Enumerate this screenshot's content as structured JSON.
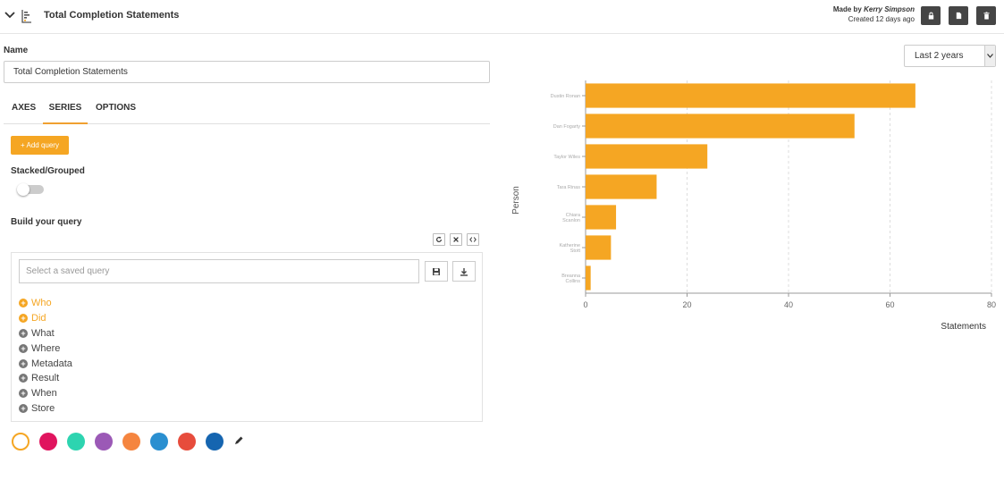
{
  "header": {
    "title": "Total Completion Statements",
    "made_by_prefix": "Made by",
    "author": "Kerry Simpson",
    "created": "Created 12 days ago",
    "buttons": [
      "lock-icon",
      "copy-icon",
      "trash-icon"
    ]
  },
  "name_field": {
    "label": "Name",
    "value": "Total Completion Statements"
  },
  "tabs": [
    {
      "label": "AXES",
      "active": false
    },
    {
      "label": "SERIES",
      "active": true
    },
    {
      "label": "OPTIONS",
      "active": false
    }
  ],
  "add_query_label": "+ Add query",
  "stacked_label": "Stacked/Grouped",
  "build_label": "Build your query",
  "saved_query_placeholder": "Select a saved query",
  "query_items": [
    {
      "label": "Who",
      "state": "active"
    },
    {
      "label": "Did",
      "state": "active"
    },
    {
      "label": "What",
      "state": "inactive"
    },
    {
      "label": "Where",
      "state": "inactive"
    },
    {
      "label": "Metadata",
      "state": "inactive"
    },
    {
      "label": "Result",
      "state": "inactive"
    },
    {
      "label": "When",
      "state": "inactive"
    },
    {
      "label": "Store",
      "state": "inactive"
    }
  ],
  "swatches": [
    "#ffffff",
    "#e0145e",
    "#2dd4b0",
    "#9b59b6",
    "#f5853f",
    "#2a8fd0",
    "#e74c3c",
    "#1565b0"
  ],
  "accent_color": "#f5a623",
  "time_range": {
    "value": "Last 2 years"
  },
  "chart_data": {
    "type": "bar",
    "orientation": "horizontal",
    "categories": [
      "Dustin Ronan",
      "Dan Fogarty",
      "Taylor Wiles",
      "Tara Rinas",
      "Chiara Scanlon",
      "Katherine Stott",
      "Breanna Collins"
    ],
    "values": [
      65,
      53,
      24,
      14,
      6,
      5,
      1
    ],
    "xlabel": "Statements",
    "ylabel": "Person",
    "xlim": [
      0,
      80
    ],
    "xticks": [
      0,
      20,
      40,
      60,
      80
    ],
    "bar_color": "#f5a623",
    "grid": "vertical dashed"
  }
}
